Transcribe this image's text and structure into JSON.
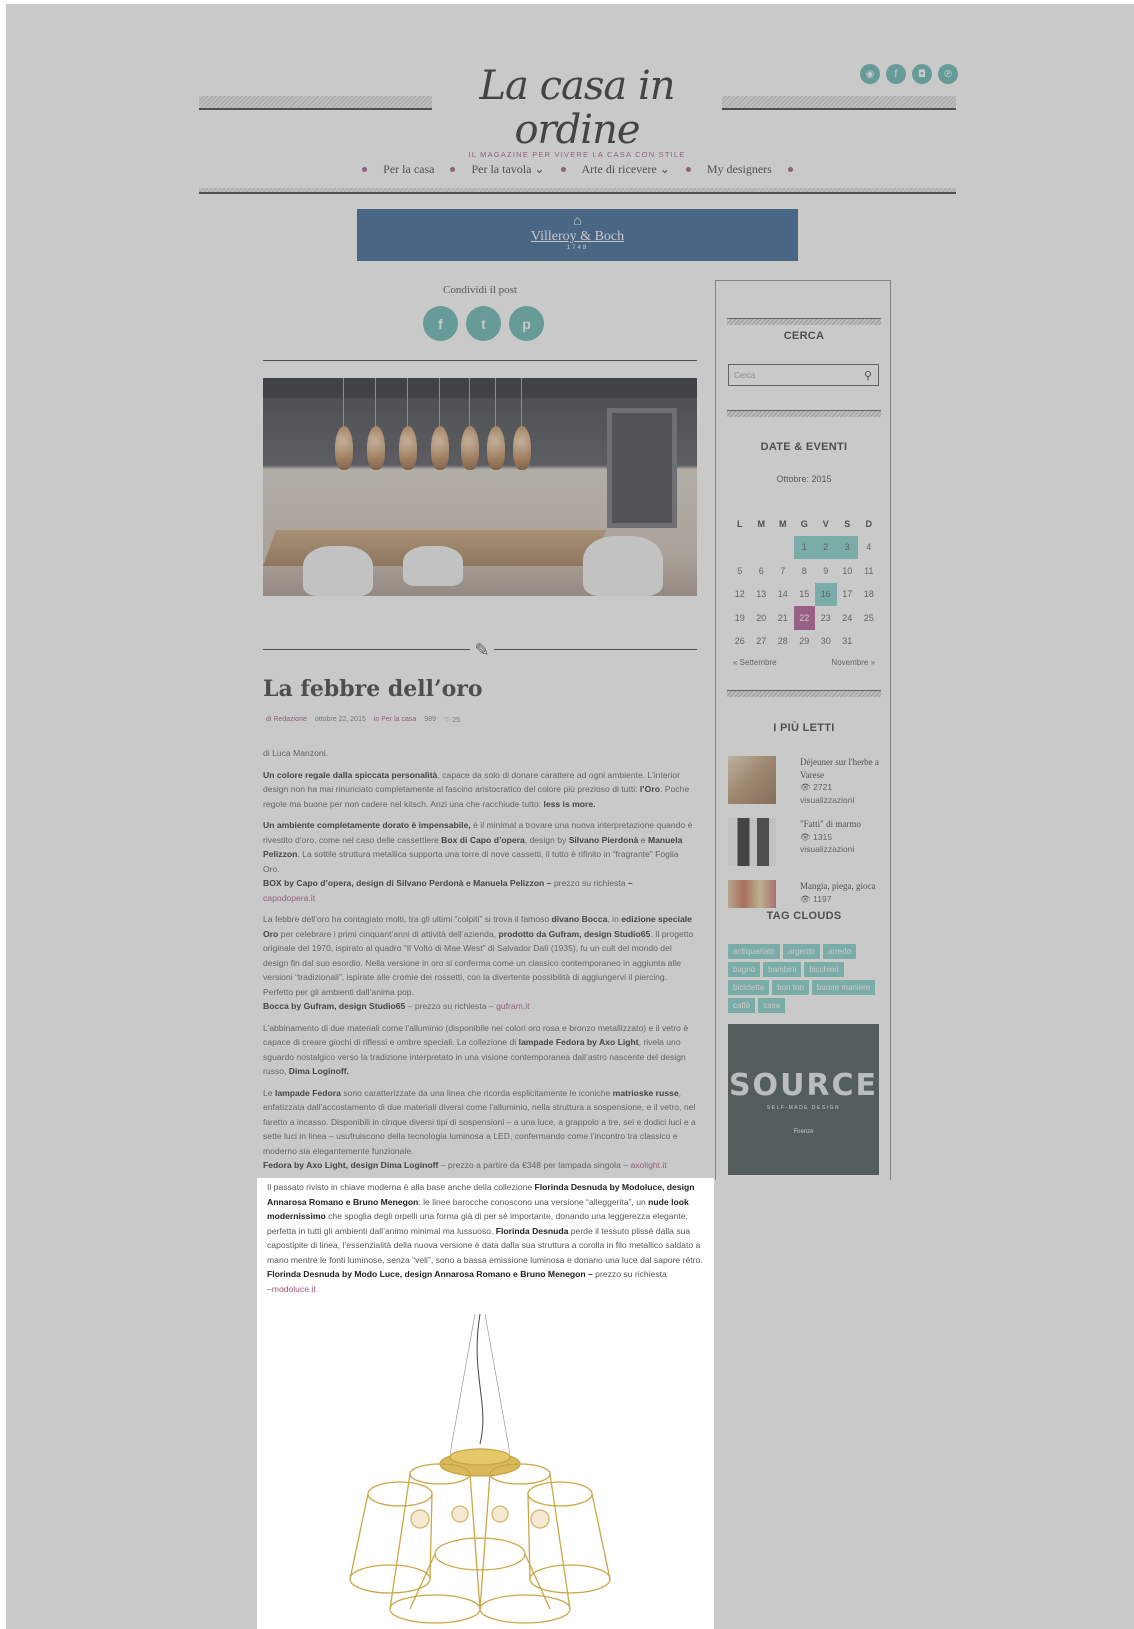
{
  "header": {
    "logo_title": "La casa in ordine",
    "logo_tagline": "IL MAGAZINE PER VIVERE LA CASA CON STILE",
    "social_icons": [
      "rss-icon",
      "facebook-icon",
      "instagram-icon",
      "pinterest-icon"
    ]
  },
  "nav": {
    "items": [
      {
        "label": "Per la casa"
      },
      {
        "label": "Per la tavola ⌄"
      },
      {
        "label": "Arte di ricevere ⌄"
      },
      {
        "label": "My designers"
      }
    ]
  },
  "banner": {
    "brand": "Villeroy & Boch",
    "year": "1748"
  },
  "share": {
    "label": "Condividi il post",
    "buttons": [
      "f",
      "t",
      "p"
    ]
  },
  "post": {
    "title": "La febbre dell’oro",
    "meta": {
      "author": "di Redazione",
      "date": "ottobre 22, 2015",
      "category": "in Per la casa",
      "views": "989",
      "likes": "♡ 25"
    },
    "byline": "di Luca Manzoni.",
    "p1_bold": "Un colore regale dalla spiccata personalità",
    "p1_text": ", capace da solo di donare carattere ad ogni ambiente. L’interior design non ha mai rinunciato completamente al fascino aristocratico del colore più prezioso di tutti: ",
    "p1_bold2": "l’Oro",
    "p1_text2": ". Poche regole ma buone per non cadere nel kitsch. Anzi una che racchiude tutto: ",
    "p1_bold3": "less is more.",
    "p2_bold": "Un ambiente completamente dorato è impensabile,",
    "p2_text": " è il minimal a trovare una nuova interpretazione quando è rivestito d’oro, come nel caso delle cassettiere ",
    "p2_bold2": "Box di Capo d’opera",
    "p2_text2": ", design by ",
    "p2_bold3": "Silvano Pierdonà",
    "p2_text3": " e ",
    "p2_bold4": "Manuela Pelizzon",
    "p2_text4": ". La sottile struttura metallica supporta una torre di nove cassetti, il tutto è rifinito in “fragrante” Foglia Oro.",
    "p2_credit": "BOX by Capo d’opera, design di Silvano Perdonà e Manuela Pelizzon –",
    "p2_price": " prezzo su richiesta ",
    "p2_dash": "–",
    "p2_link": "capodopera.it",
    "p3_text": "La febbre dell’oro ha contagiato molti, tra gli ultimi “colpiti” si trova il famoso ",
    "p3_bold": "divano Bocca",
    "p3_text2": ", in ",
    "p3_bold2": "edizione speciale Oro",
    "p3_text3": " per celebrare i primi cinquant’anni di attività dell’azienda, ",
    "p3_bold3": "prodotto da Gufram, design Studio65",
    "p3_text4": ". Il progetto originale del 1970, ispirato al quadro “Il Volto di Mae West” di Salvador Dalì (1935), fu un cult del mondo del design fin dal suo esordio. Nella versione in oro si conferma come un classico contemporaneo in aggiunta alle versioni “tradizionali”, ispirate alle cromie dei rossetti, con la divertente possibilità di aggiungervi il piercing. Perfetto per gli ambienti dall’anima pop.",
    "p3_credit": "Bocca by Gufram, design Studio65",
    "p3_price": " – prezzo su richiesta – ",
    "p3_link": "gufram.it",
    "p4_text": "L’abbinamento di due materiali come l’alluminio (disponibile nei colori oro rosa e bronzo metallizzato) e il vetro è capace di creare giochi di riflessi e ombre speciali. La collezione di ",
    "p4_bold": "lampade Fedora by Axo Light",
    "p4_text2": ", rivela uno sguardo nostalgico verso la tradizione interpretato in una visione contemporanea dall’astro nascente del design russo, ",
    "p4_bold2": "Dima Loginoff.",
    "p5_text": "Le ",
    "p5_bold": "lampade Fedora",
    "p5_text2": " sono caratterizzate da una linea che ricorda esplicitamente le iconiche ",
    "p5_bold2": "matrioske russe",
    "p5_text3": ", enfatizzata dall’accostamento di due materiali diversi come l’alluminio, nella struttura a sospensione, e il vetro, nel faretto a incasso. Disponibili in cinque diversi tipi di sospensioni – a una luce, a grappolo a tre, sei e dodici luci e a sette luci in linea – usufruiscono della tecnologia luminosa a LED, confermando come l’incontro tra classico e moderno sia elegantemente funzionale.",
    "p5_credit": "Fedora by Axo Light, design Dima Loginoff",
    "p5_price": " – prezzo a partire da €348 per lampada singola – ",
    "p5_link": "axolight.it",
    "p6_text": "Il passato rivisto in chiave moderna è alla base anche della collezione ",
    "p6_bold": "Florinda Desnuda by Modoluce, design Annarosa Romano e Bruno Menegon",
    "p6_text2": ": le linee barocche conoscono una versione “alleggerita”, un ",
    "p6_bold2": "nude look modernissimo",
    "p6_text3": " che spoglia degli orpelli una forma già di per sé importante, donando una leggerezza elegante, perfetta in tutti gli ambienti dall’animo minimal ma lussuoso. ",
    "p6_bold3": "Florinda Desnuda",
    "p6_text4": " perde il tessuto plissé dalla sua capostipite di linea, l’essenzialità della nuova versione è data dalla sua struttura a corolla in filo metallico saldato a mano mentre le fonti luminose, senza “veli”, sono a bassa emissione luminosa e donano una luce dal sapore rétro.",
    "p6_credit": "Florinda Desnuda by Modo Luce, design Annarosa Romano e Bruno Menegon –",
    "p6_price": " prezzo su richiesta ",
    "p6_dash": "–",
    "p6_link": "modoluce.it"
  },
  "sidebar": {
    "search_title": "CERCA",
    "search_placeholder": "Cerca",
    "events_title": "DATE & EVENTI",
    "calendar": {
      "month": "Ottobre: 2015",
      "weekdays": [
        "L",
        "M",
        "M",
        "G",
        "V",
        "S",
        "D"
      ],
      "prev": "« Settembre",
      "next": "Novembre »"
    },
    "popular_title": "I PIÙ LETTI",
    "popular": [
      {
        "title": "Déjeuner sur l'herbe a Varese",
        "views": "👁 2721 visualizzazioni"
      },
      {
        "title": "\"Fatti\" di marmo",
        "views": "👁 1315 visualizzazioni"
      },
      {
        "title": "Mangia, piega, gioca",
        "views": "👁 1197"
      }
    ],
    "tags_title": "TAG CLOUDS",
    "tags": [
      "antiquariato",
      "argento",
      "arredo",
      "bagno",
      "bambini",
      "bicchieri",
      "bicicletta",
      "bon ton",
      "buone maniere",
      "caffè",
      "casa"
    ],
    "ad": {
      "title": "SOURCE",
      "subtitle": "SELF-MADE DESIGN",
      "city": "Firenze"
    }
  }
}
